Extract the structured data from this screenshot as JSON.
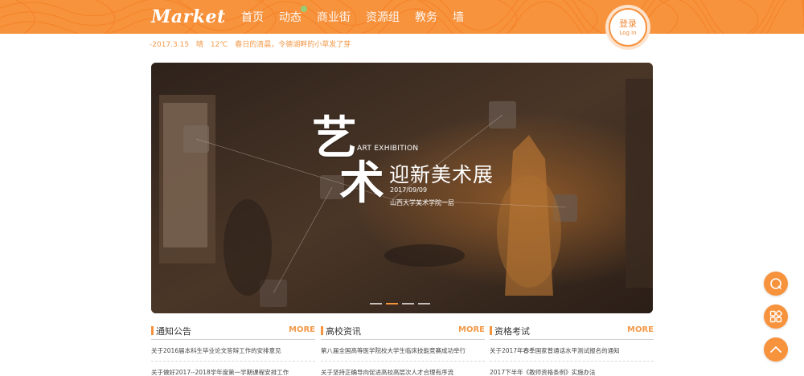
{
  "header": {
    "logo": "Market",
    "nav": [
      "首页",
      "动态",
      "商业街",
      "资源组",
      "教务",
      "墙"
    ],
    "login_cn": "登录",
    "login_en": "Log in",
    "bg_color": "#f7923d"
  },
  "weather": {
    "date": "-2017.3.15",
    "condition": "晴",
    "temp": "12℃",
    "message": "春日的清晨，令德湖畔的小草发了芽"
  },
  "banner": {
    "char1": "艺",
    "char2": "术",
    "en_title": "ART EXHIBITION",
    "cn_title": "迎新美术展",
    "date": "2017/09/09",
    "place": "山西大学美术学院一层",
    "slide_count": 4,
    "active_slide": 2
  },
  "columns": [
    {
      "title": "通知公告",
      "more": "MORE",
      "items": [
        "关于2016届本科生毕业论文答辩工作的安排意见",
        "关于做好2017--2018学年度第一学期课程安排工作"
      ]
    },
    {
      "title": "高校资讯",
      "more": "MORE",
      "items": [
        "第八届全国高等医学院校大学生临床技能竞赛成功举行",
        "关于坚持正确导向促进高校高层次人才合理有序流"
      ]
    },
    {
      "title": "资格考试",
      "more": "MORE",
      "items": [
        "关于2017年春季国家普通话水平测试报名的通知",
        "2017下半年《教师资格条例》实施办法"
      ]
    }
  ],
  "float_buttons": [
    "chat-icon",
    "grid-icon",
    "arrow-up-icon"
  ],
  "accent": "#f7923d"
}
